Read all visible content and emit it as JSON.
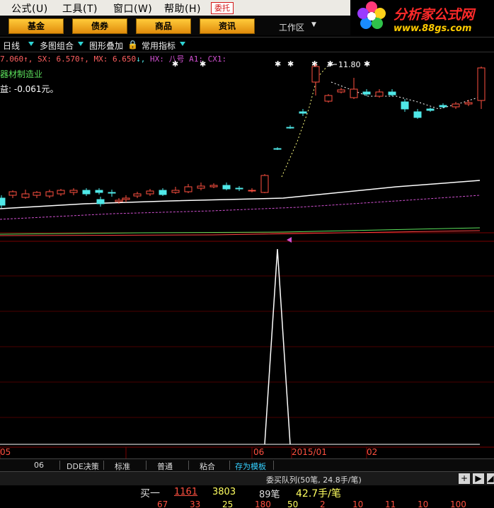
{
  "menubar": {
    "items": [
      "公式(U)",
      "工具(T)",
      "窗口(W)",
      "帮助(H)"
    ],
    "order_button": "委托"
  },
  "toolbar": {
    "buttons": [
      "基金",
      "债券",
      "商品",
      "资讯"
    ],
    "workspace": "工作区"
  },
  "logo": {
    "title": "分析家公式网",
    "url_text": "www.88gs.com"
  },
  "subbar": {
    "period": "日线",
    "multi_chart": "多图组合",
    "overlay": "图形叠加",
    "common_indicators": "常用指标"
  },
  "indicators": {
    "v1": "7.060",
    "sx_label": "SX: 6.570",
    "mx_label": "MX: 6.650",
    "hx_label": "HX: 八号",
    "a1_label": "A1:",
    "cx1_label": "CX1:",
    "industry": "器材制造业",
    "eps": "益: -0.061元。",
    "peak_price": "11.80"
  },
  "axis": {
    "labels": [
      "05",
      "06",
      "2015/01",
      "02"
    ]
  },
  "bottom_tabs": [
    "06",
    "DDE决策",
    "标准",
    "普通",
    "粘合",
    "存为模板"
  ],
  "queue": {
    "title": "委买队列(50笔, 24.8手/笔)"
  },
  "buy_row": {
    "label": "买一",
    "price": "1161",
    "volume": "3803",
    "count": "89笔",
    "avg": "42.7手/笔",
    "partial": [
      "67",
      "33",
      "25",
      "180",
      "50",
      "2",
      "10",
      "11",
      "10",
      "100"
    ]
  },
  "colors": {
    "up": "#ff5040",
    "down": "#4fe8e8",
    "ma_white": "#ffffff",
    "ma_purple": "#d050d0",
    "grid_red": "#7a0000",
    "accent_cyan": "#35d0ff"
  }
}
